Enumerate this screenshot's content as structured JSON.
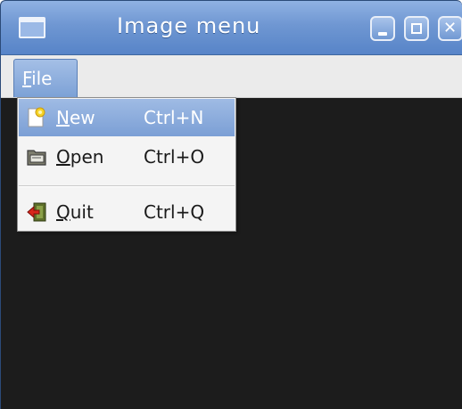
{
  "window": {
    "title": "Image menu",
    "controls": [
      "minimize-icon",
      "maximize-icon",
      "close-icon"
    ]
  },
  "menubar": {
    "file_mnemonic": "F",
    "file_rest": "ile"
  },
  "file_menu": {
    "items": [
      {
        "mnemonic": "N",
        "rest": "ew",
        "accelerator": "Ctrl+N",
        "icon": "new-document-icon",
        "selected": true
      },
      {
        "mnemonic": "O",
        "rest": "pen",
        "accelerator": "Ctrl+O",
        "icon": "open-folder-icon",
        "selected": false
      },
      {
        "mnemonic": "Q",
        "rest": "uit",
        "accelerator": "Ctrl+Q",
        "icon": "quit-exit-icon",
        "selected": false
      }
    ]
  },
  "colors": {
    "titlebar": "#6f97d2",
    "selection": "#8aaedd",
    "content_background": "#1c1c1c",
    "menu_background": "#f4f4f4"
  }
}
